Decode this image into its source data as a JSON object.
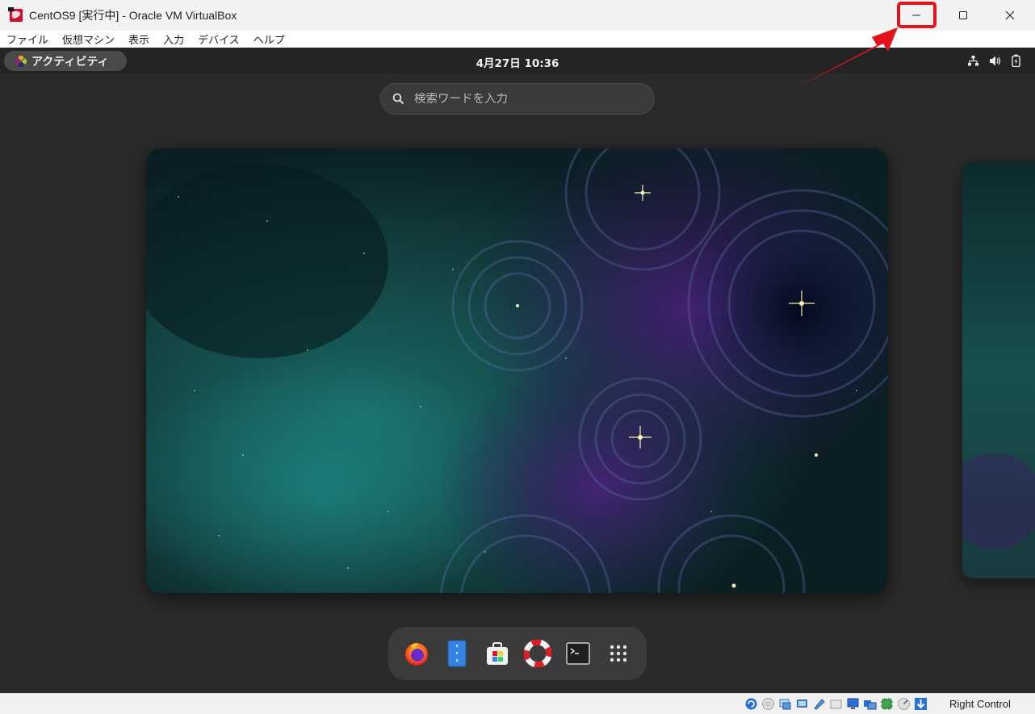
{
  "window": {
    "title": "CentOS9 [実行中] - Oracle VM VirtualBox",
    "controls": [
      "minimize-icon",
      "maximize-icon",
      "close-icon"
    ],
    "highlight_color": "#e5121b"
  },
  "menubar": {
    "items": [
      {
        "label": "ファイル"
      },
      {
        "label": "仮想マシン"
      },
      {
        "label": "表示"
      },
      {
        "label": "入力"
      },
      {
        "label": "デバイス"
      },
      {
        "label": "ヘルプ"
      }
    ]
  },
  "guest": {
    "activities_label": "アクティビティ",
    "clock": "4月27日  10:36",
    "tray_icons": [
      "network-icon",
      "volume-icon",
      "battery-icon"
    ],
    "search_placeholder": "検索ワードを入力",
    "dock": [
      {
        "name": "firefox-icon"
      },
      {
        "name": "files-icon"
      },
      {
        "name": "software-icon"
      },
      {
        "name": "help-icon"
      },
      {
        "name": "terminal-icon"
      },
      {
        "name": "app-grid-icon"
      }
    ]
  },
  "statusbar": {
    "host_key": "Right Control",
    "icons": [
      "hard-disk-icon",
      "optical-drive-icon",
      "audio-icon",
      "network-adapter-icon",
      "usb-icon",
      "shared-folders-icon",
      "display-icon",
      "recording-icon",
      "cpu-icon",
      "mouse-integration-icon",
      "host-key-arrow-icon"
    ]
  }
}
